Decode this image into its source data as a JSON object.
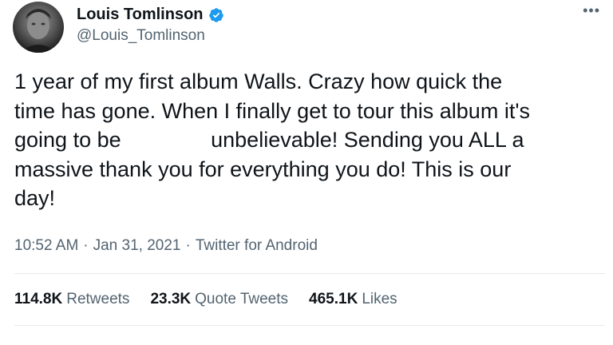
{
  "author": {
    "name": "Louis Tomlinson",
    "handle": "@Louis_Tomlinson",
    "verified_color": "#1d9bf0"
  },
  "tweet": {
    "text": "1 year of my first album Walls. Crazy how quick the\ntime has gone. When I finally get to tour this album it's\ngoing to be               unbelievable! Sending you ALL a\nmassive thank you for everything you do! This is our\nday!",
    "time": "10:52 AM",
    "date": "Jan 31, 2021",
    "source": "Twitter for Android",
    "separator": "·"
  },
  "stats": {
    "retweets_count": "114.8K",
    "retweets_label": "Retweets",
    "quotes_count": "23.3K",
    "quotes_label": "Quote Tweets",
    "likes_count": "465.1K",
    "likes_label": "Likes"
  },
  "icons": {
    "more": "more-horizontal-icon",
    "verified": "verified-badge-icon"
  }
}
